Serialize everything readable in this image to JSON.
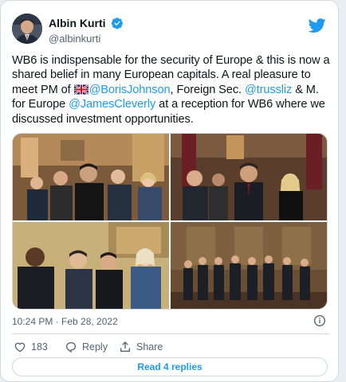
{
  "author": {
    "display_name": "Albin Kurti",
    "handle": "@albinkurti",
    "avatar_icon": "profile-photo",
    "verified_icon": "verified-badge-icon"
  },
  "brand": {
    "icon": "twitter-bird-icon",
    "accent": "#1d9bf0"
  },
  "tweet": {
    "text_1": "WB6 is indispensable for the security of Europe & this is now a shared belief in many European capitals. A real pleasure to meet PM of ",
    "flag_icon": "uk-flag-emoji",
    "mention_1": "@BorisJohnson",
    "text_2": ", Foreign Sec. ",
    "mention_2": "@trussliz",
    "text_3": " & M. for Europe ",
    "mention_3": "@JamesCleverly",
    "text_4": " at a reception for WB6 where we discussed investment opportunities."
  },
  "media": {
    "photos": [
      "reception-photo-1",
      "reception-photo-2",
      "reception-photo-3",
      "reception-photo-4"
    ]
  },
  "meta": {
    "timestamp": "10:24 PM · Feb 28, 2022",
    "info_icon": "info-icon"
  },
  "actions": {
    "like_count": "183",
    "reply_label": "Reply",
    "share_label": "Share"
  },
  "replies_button": "Read 4 replies"
}
